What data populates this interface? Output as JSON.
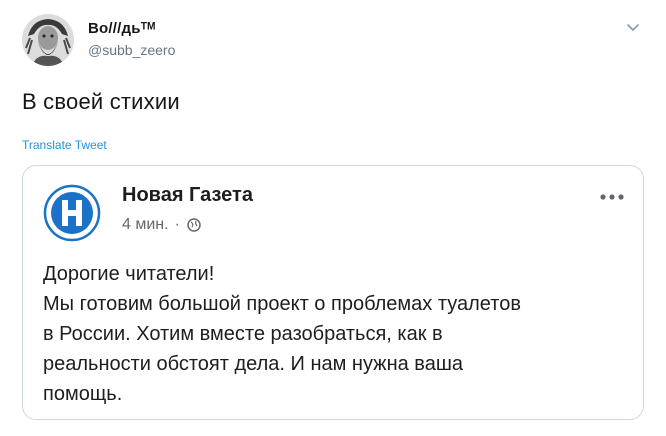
{
  "tweet": {
    "display_name": "Во///дьᵀᴹ",
    "handle": "@subb_zeero",
    "text": "В своей стихии",
    "translate_label": "Translate Tweet",
    "avatar_icon": "bearded-man-avatar",
    "menu_icon": "chevron-down-icon"
  },
  "embedded_post": {
    "page_name": "Новая Газета",
    "time": "4 мин.",
    "separator": "·",
    "privacy_icon": "globe-icon",
    "more_icon": "more-dots-icon",
    "logo_color": "#1a73c9",
    "body_lines": [
      "Дорогие читатели!",
      "Мы готовим большой проект о проблемах туалетов",
      "в России. Хотим вместе разобраться, как в",
      "реальности обстоят дела. И нам нужна ваша",
      "помощь."
    ]
  }
}
